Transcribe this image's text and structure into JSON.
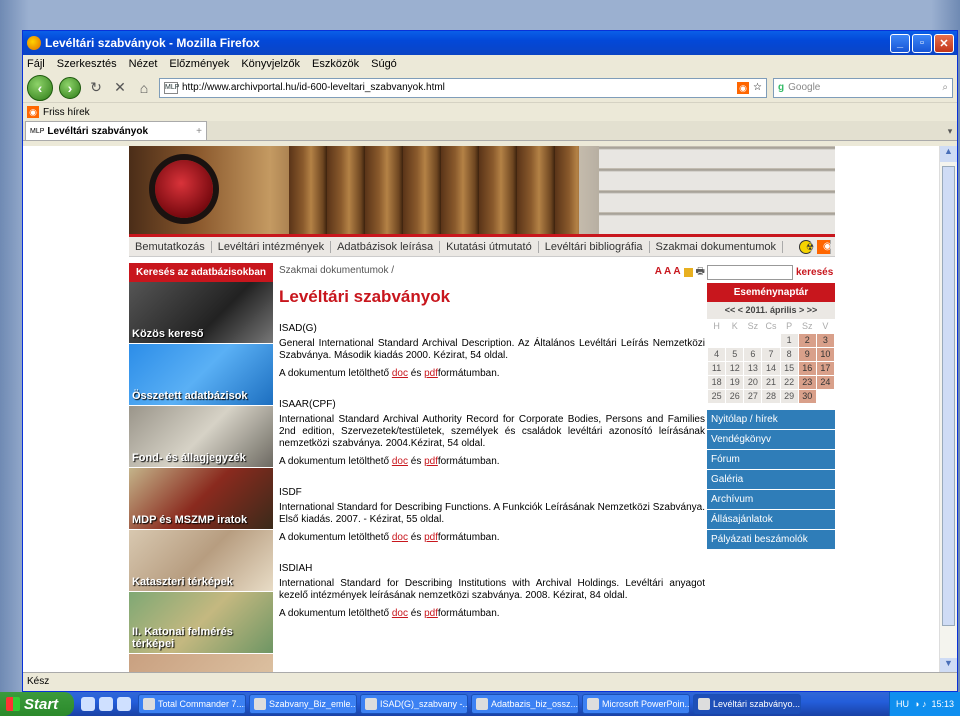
{
  "window": {
    "title": "Levéltári szabványok - Mozilla Firefox"
  },
  "menubar": [
    "Fájl",
    "Szerkesztés",
    "Nézet",
    "Előzmények",
    "Könyvjelzők",
    "Eszközök",
    "Súgó"
  ],
  "navbar": {
    "url": "http://www.archivportal.hu/id-600-leveltari_szabvanyok.html",
    "search_placeholder": "Google",
    "fav_label": "MLP"
  },
  "bookmarks": {
    "item": "Friss hírek"
  },
  "tab": {
    "title": "Levéltári szabványok",
    "new_tab": "+"
  },
  "status": "Kész",
  "site": {
    "nav": [
      "Bemutatkozás",
      "Levéltári intézmények",
      "Adatbázisok leírása",
      "Kutatási útmutató",
      "Levéltári bibliográfia",
      "Szakmai dokumentumok"
    ],
    "left_header": "Keresés az adatbázisokban",
    "left_tiles": [
      "Közös kereső",
      "Összetett adatbázisok",
      "Fond- és állagjegyzék",
      "MDP és MSZMP iratok",
      "Kataszteri térképek",
      "II. Katonai felmérés térképei"
    ],
    "breadcrumb": "Szakmai dokumentumok /",
    "tools_text": "A A A",
    "page_title": "Levéltári szabványok",
    "docs": [
      {
        "name": "ISAD(G)",
        "desc": "General International Standard Archival Description. Az Általános Levéltári Leírás Nemzetközi Szabványa. Második kiadás 2000. Kézirat, 54 oldal.",
        "dl_pre": "A dokumentum letölthető",
        "doc": "doc",
        "and": "és",
        "pdf": "pdf",
        "dl_post": "formátumban."
      },
      {
        "name": "ISAAR(CPF)",
        "desc": "International Standard Archival Authority Record for Corporate Bodies, Persons and Families 2nd edition, Szervezetek/testületek, személyek és családok levéltári azonosító leírásának nemzetközi szabványa. 2004.Kézirat, 54 oldal.",
        "dl_pre": "A dokumentum letölthető",
        "doc": "doc",
        "and": "és",
        "pdf": "pdf",
        "dl_post": "formátumban."
      },
      {
        "name": "ISDF",
        "desc": "International Standard for Describing Functions. A Funkciók Leírásának Nemzetközi Szabványa. Első kiadás. 2007. - Kézirat, 55 oldal.",
        "dl_pre": "A dokumentum letölthető",
        "doc": "doc",
        "and": "és",
        "pdf": "pdf",
        "dl_post": "formátumban."
      },
      {
        "name": "ISDIAH",
        "desc": "International Standard for Describing Institutions with Archival Holdings. Levéltári anyagot kezelő intézmények leírásának nemzetközi szabványa. 2008. Kézirat, 84 oldal.",
        "dl_pre": "A dokumentum letölthető",
        "doc": "doc",
        "and": "és",
        "pdf": "pdf",
        "dl_post": "formátumban."
      }
    ],
    "search_label": "keresés",
    "calendar": {
      "title": "Eseménynaptár",
      "nav": "<< < 2011. április > >>",
      "headers": [
        "H",
        "K",
        "Sz",
        "Cs",
        "P",
        "Sz",
        "V"
      ],
      "weeks": [
        [
          "",
          "",
          "",
          "",
          "1",
          "2",
          "3"
        ],
        [
          "4",
          "5",
          "6",
          "7",
          "8",
          "9",
          "10"
        ],
        [
          "11",
          "12",
          "13",
          "14",
          "15",
          "16",
          "17"
        ],
        [
          "18",
          "19",
          "20",
          "21",
          "22",
          "23",
          "24"
        ],
        [
          "25",
          "26",
          "27",
          "28",
          "29",
          "30",
          ""
        ]
      ]
    },
    "right_menu": [
      "Nyitólap / hírek",
      "Vendégkönyv",
      "Fórum",
      "Galéria",
      "Archívum",
      "Állásajánlatok",
      "Pályázati beszámolók"
    ]
  },
  "taskbar": {
    "start": "Start",
    "tasks": [
      "Total Commander 7....",
      "Szabvany_Biz_emle...",
      "ISAD(G)_szabvany -...",
      "Adatbazis_biz_ossz...",
      "Microsoft PowerPoin...",
      "Levéltári szabványo..."
    ],
    "lang": "HU",
    "time": "15:13"
  }
}
